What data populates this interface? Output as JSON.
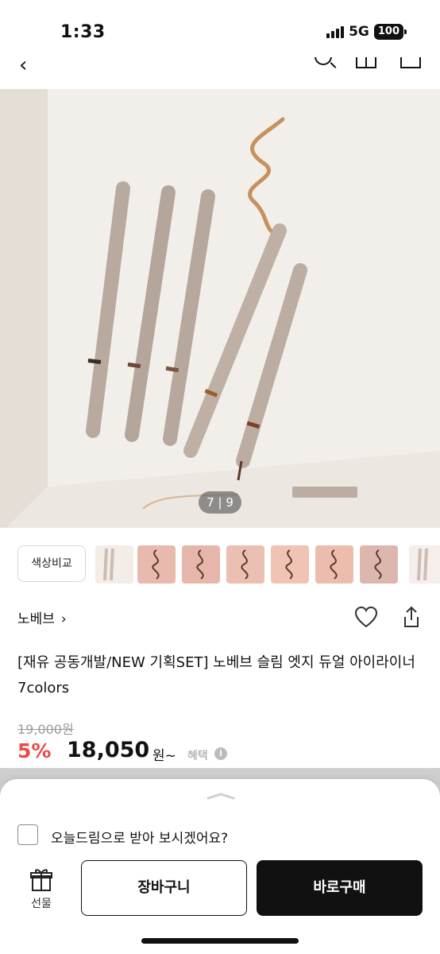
{
  "status_bar": {
    "time": "1:33",
    "network": "5G",
    "battery": "100"
  },
  "gallery": {
    "current": "7",
    "total": "9",
    "separator": "|"
  },
  "compare_label": "색상비교",
  "thumbnails": [
    {
      "name": "thumb-pencil-1",
      "color": "#f4ece6"
    },
    {
      "name": "thumb-swatch-1",
      "color": "#e8b9ad"
    },
    {
      "name": "thumb-swatch-2",
      "color": "#e6b6ab"
    },
    {
      "name": "thumb-swatch-3",
      "color": "#ebbfb2"
    },
    {
      "name": "thumb-swatch-4",
      "color": "#f0c3b4"
    },
    {
      "name": "thumb-swatch-5",
      "color": "#ecbcad"
    },
    {
      "name": "thumb-swatch-6",
      "color": "#dcb7ae"
    },
    {
      "name": "thumb-pencil-2",
      "color": "#f5eeea"
    }
  ],
  "brand": {
    "name": "노베브",
    "chevron": "›"
  },
  "product": {
    "title": "[재유 공동개발/NEW 기획SET] 노베브 슬림 엣지 듀얼 아이라이너 7colors",
    "original_price": "19,000원",
    "discount": "5%",
    "price": "18,050",
    "price_unit": "원~",
    "benefit_label": "혜택",
    "info_mark": "i"
  },
  "sheet": {
    "checkbox_label": "오늘드림으로 받아 보시겠어요?",
    "gift_label": "선물",
    "cart_label": "장바구니",
    "buy_label": "바로구매"
  },
  "colors": {
    "discount": "#ea4a4a",
    "primary_button": "#111111",
    "pencil": "#b9aaa0"
  }
}
